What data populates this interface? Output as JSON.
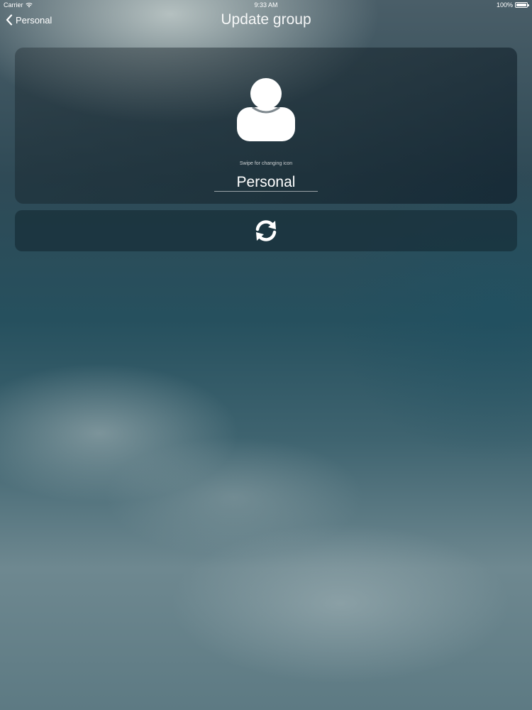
{
  "status_bar": {
    "carrier": "Carrier",
    "time": "9:33 AM",
    "battery": "100%"
  },
  "nav": {
    "back_label": "Personal",
    "title": "Update group"
  },
  "group": {
    "icon": "person-icon",
    "hint": "Swipe for changing icon",
    "name": "Personal"
  },
  "actions": {
    "refresh_icon": "refresh-icon"
  }
}
